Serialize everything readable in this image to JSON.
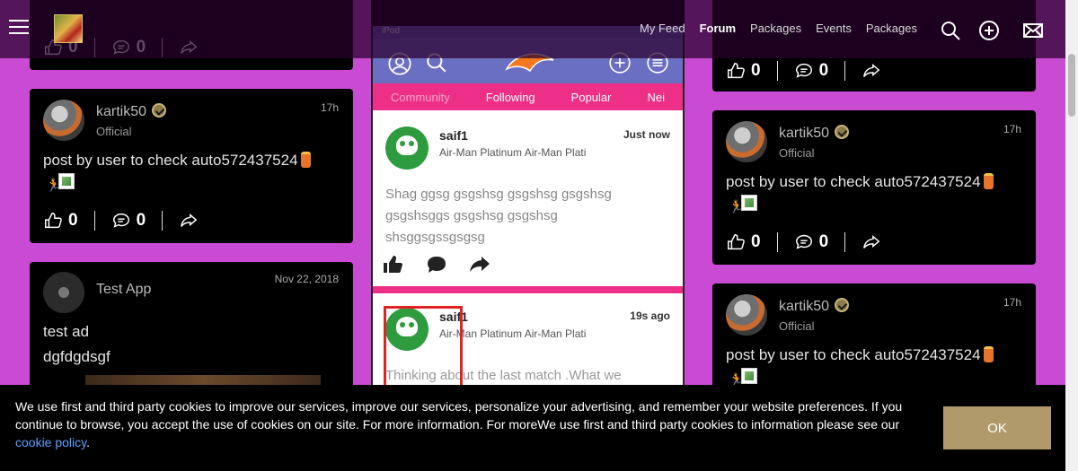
{
  "nav": {
    "items": [
      "My Feed",
      "Forum",
      "Packages",
      "Events",
      "Packages"
    ],
    "active": "Forum"
  },
  "posts": {
    "top_left": {
      "likes": "0",
      "comments": "0"
    },
    "top_right": {
      "likes": "0",
      "comments": "0"
    },
    "left_1": {
      "user": "kartik50",
      "role": "Official",
      "time": "17h",
      "text": "post by user to check auto572437524",
      "likes": "0",
      "comments": "0"
    },
    "left_2": {
      "user": "Test App",
      "time": "Nov 22, 2018",
      "line1": "test ad",
      "line2": "dgfdgdsgf"
    },
    "right_1": {
      "user": "kartik50",
      "role": "Official",
      "time": "17h",
      "text": "post by user to check auto572437524",
      "likes": "0",
      "comments": "0"
    },
    "right_2": {
      "user": "kartik50",
      "role": "Official",
      "time": "17h",
      "text": "post by user to check auto572437524"
    }
  },
  "screenshot": {
    "status": "iPod",
    "tabs": [
      "Community",
      "Following",
      "Popular",
      "Nei"
    ],
    "post1": {
      "name": "saif1",
      "sub": "Air-Man Platinum Air-Man Plati",
      "time": "Just now",
      "body": "Shag ggsg gsgshsg gsgshsg gsgshsg gsgshsggs gsgshsg gsgshsg shsggsgssgsgsg"
    },
    "post2": {
      "name": "saif1",
      "sub": "Air-Man Platinum Air-Man Plati",
      "time": "19s ago",
      "body": "Thinking about the last match .What we"
    }
  },
  "cookie": {
    "text": "We use first and third party cookies to improve our services, improve our services, personalize your advertising, and remember your website preferences. If you continue to browse, you accept the use of cookies on our site. For more information. For moreWe use first and third party cookies to information please see our ",
    "link": "cookie policy",
    "end": ".",
    "ok": "OK"
  },
  "colors": {
    "page_bg": "#c94bd3",
    "accent_gold": "#b09a6a",
    "pink": "#ee2f87"
  }
}
